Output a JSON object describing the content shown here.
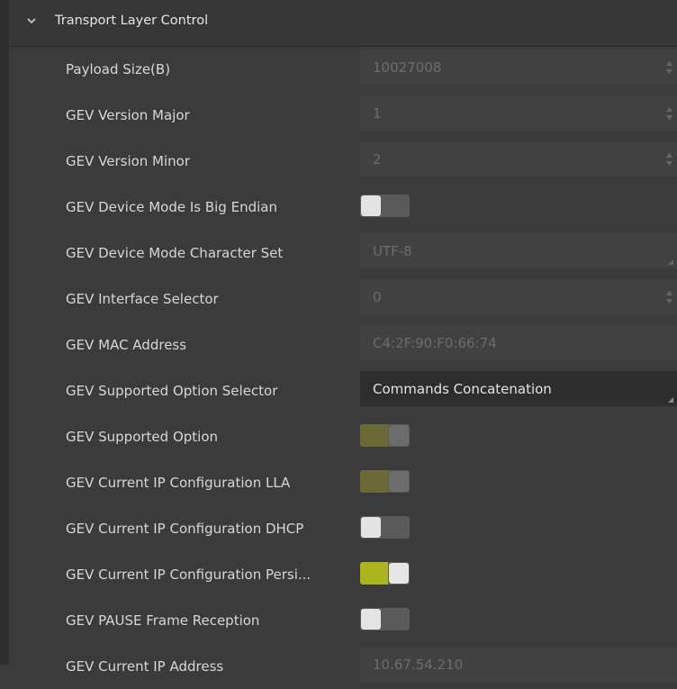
{
  "section": {
    "title": "Transport Layer Control",
    "expanded_icon": "chevron-down-icon"
  },
  "rows": [
    {
      "label": "Payload Size(B)",
      "kind": "spin",
      "value": "10027008",
      "editable": false
    },
    {
      "label": "GEV Version Major",
      "kind": "spin",
      "value": "1",
      "editable": false
    },
    {
      "label": "GEV Version Minor",
      "kind": "spin",
      "value": "2",
      "editable": false
    },
    {
      "label": "GEV Device Mode Is Big Endian",
      "kind": "toggle",
      "state": "off",
      "enabled": false
    },
    {
      "label": "GEV Device Mode Character Set",
      "kind": "select",
      "value": "UTF-8",
      "editable": false
    },
    {
      "label": "GEV Interface Selector",
      "kind": "spin",
      "value": "0",
      "editable": false
    },
    {
      "label": "GEV MAC Address",
      "kind": "text",
      "value": "C4:2F:90:F0:66:74",
      "editable": false
    },
    {
      "label": "GEV Supported Option Selector",
      "kind": "select",
      "value": "Commands Concatenation",
      "editable": true
    },
    {
      "label": "GEV Supported Option",
      "kind": "toggle",
      "state": "on",
      "enabled": false
    },
    {
      "label": "GEV Current IP Configuration LLA",
      "kind": "toggle",
      "state": "on",
      "enabled": false
    },
    {
      "label": "GEV Current IP Configuration DHCP",
      "kind": "toggle",
      "state": "off",
      "enabled": true
    },
    {
      "label": "GEV Current IP Configuration Persi...",
      "kind": "toggle",
      "state": "on",
      "enabled": true
    },
    {
      "label": "GEV PAUSE Frame Reception",
      "kind": "toggle",
      "state": "off",
      "enabled": true
    },
    {
      "label": "GEV Current IP Address",
      "kind": "text",
      "value": "10.67.54.210",
      "editable": false
    }
  ],
  "colors": {
    "toggle_on": "#aab61c",
    "toggle_on_disabled": "#6b6a36",
    "panel": "#3b3b3b"
  }
}
